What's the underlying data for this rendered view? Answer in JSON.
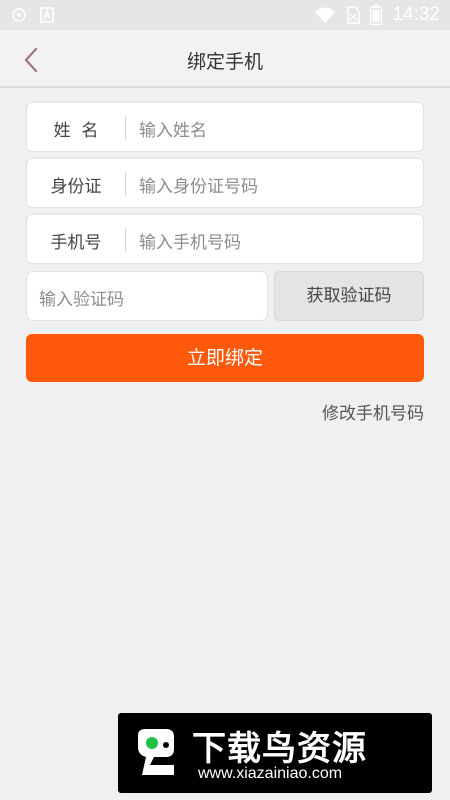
{
  "status_bar": {
    "time": "14:32",
    "icons": [
      "notification-icon",
      "a-icon",
      "wifi-icon",
      "sim-icon",
      "battery-icon"
    ]
  },
  "header": {
    "title": "绑定手机",
    "back_icon": "chevron-left-icon"
  },
  "form": {
    "name": {
      "label": "姓  名",
      "placeholder": "输入姓名"
    },
    "id_card": {
      "label": "身份证",
      "placeholder": "输入身份证号码"
    },
    "phone": {
      "label": "手机号",
      "placeholder": "输入手机号码"
    },
    "code": {
      "placeholder": "输入验证码",
      "button_label": "获取验证码"
    },
    "submit_label": "立即绑定",
    "change_phone_link": "修改手机号码"
  },
  "watermark": {
    "title": "下载鸟资源",
    "url": "www.xiazainiao.com"
  },
  "colors": {
    "accent": "#ff5a0b",
    "background": "#f0f0f0"
  }
}
